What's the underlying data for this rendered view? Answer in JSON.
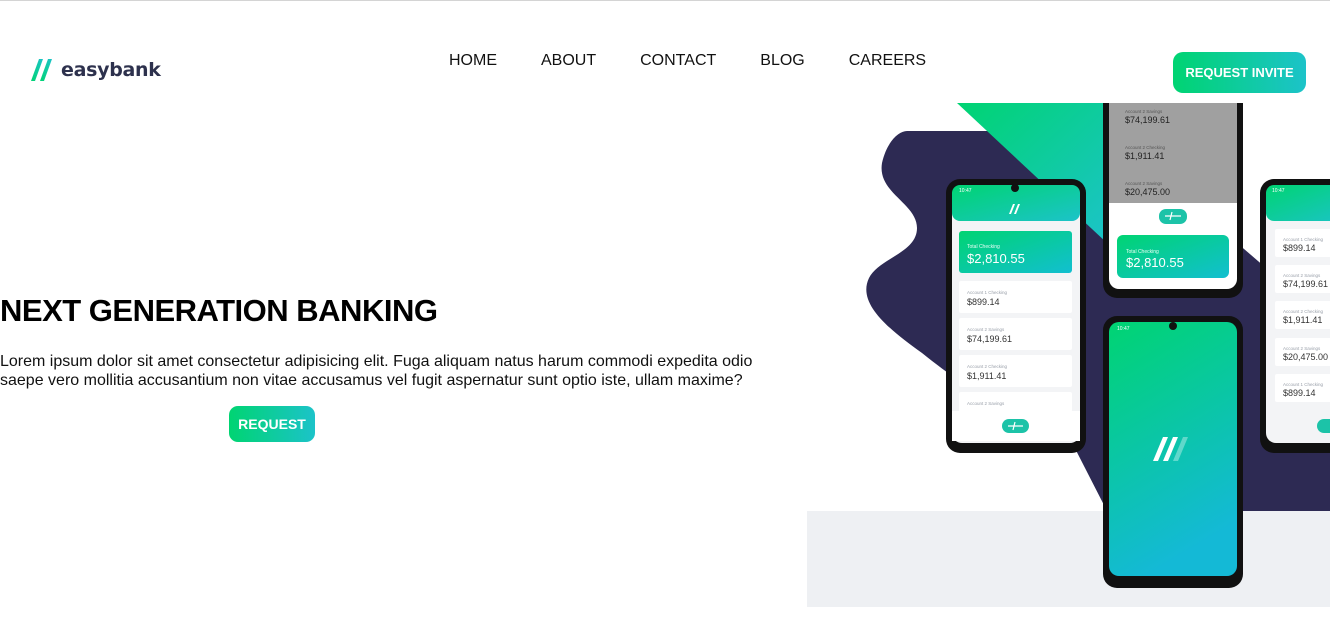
{
  "header": {
    "logo_text": "easybank",
    "nav": [
      "HOME",
      "ABOUT",
      "CONTACT",
      "BLOG",
      "CAREERS"
    ],
    "cta_label": "REQUEST INVITE"
  },
  "hero": {
    "title": "NEXT GENERATION BANKING",
    "description": "Lorem ipsum dolor sit amet consectetur adipisicing elit. Fuga aliquam natus harum commodi expedita odio saepe vero mollitia accusantium non vitae accusamus vel fugit aspernatur sunt optio iste, ullam maxime?",
    "button_label": "REQUEST"
  },
  "mockup": {
    "total_label": "Total Checking",
    "total_amount": "$2,810.55",
    "accounts": [
      {
        "label": "Account 1 Checking",
        "amount": "$899.14"
      },
      {
        "label": "Account 2 Savings",
        "amount": "$74,199.61"
      },
      {
        "label": "Account 2 Checking",
        "amount": "$1,911.41"
      },
      {
        "label": "Account 2 Savings",
        "amount": "$20,475.00"
      },
      {
        "label": "Account 1 Checking",
        "amount": "$899.14"
      }
    ],
    "time": "10:47"
  },
  "colors": {
    "brand_green": "#00d472",
    "brand_cyan": "#1cc3c9",
    "dark_blue": "#2d314d",
    "light_gray": "#eef0f3"
  }
}
